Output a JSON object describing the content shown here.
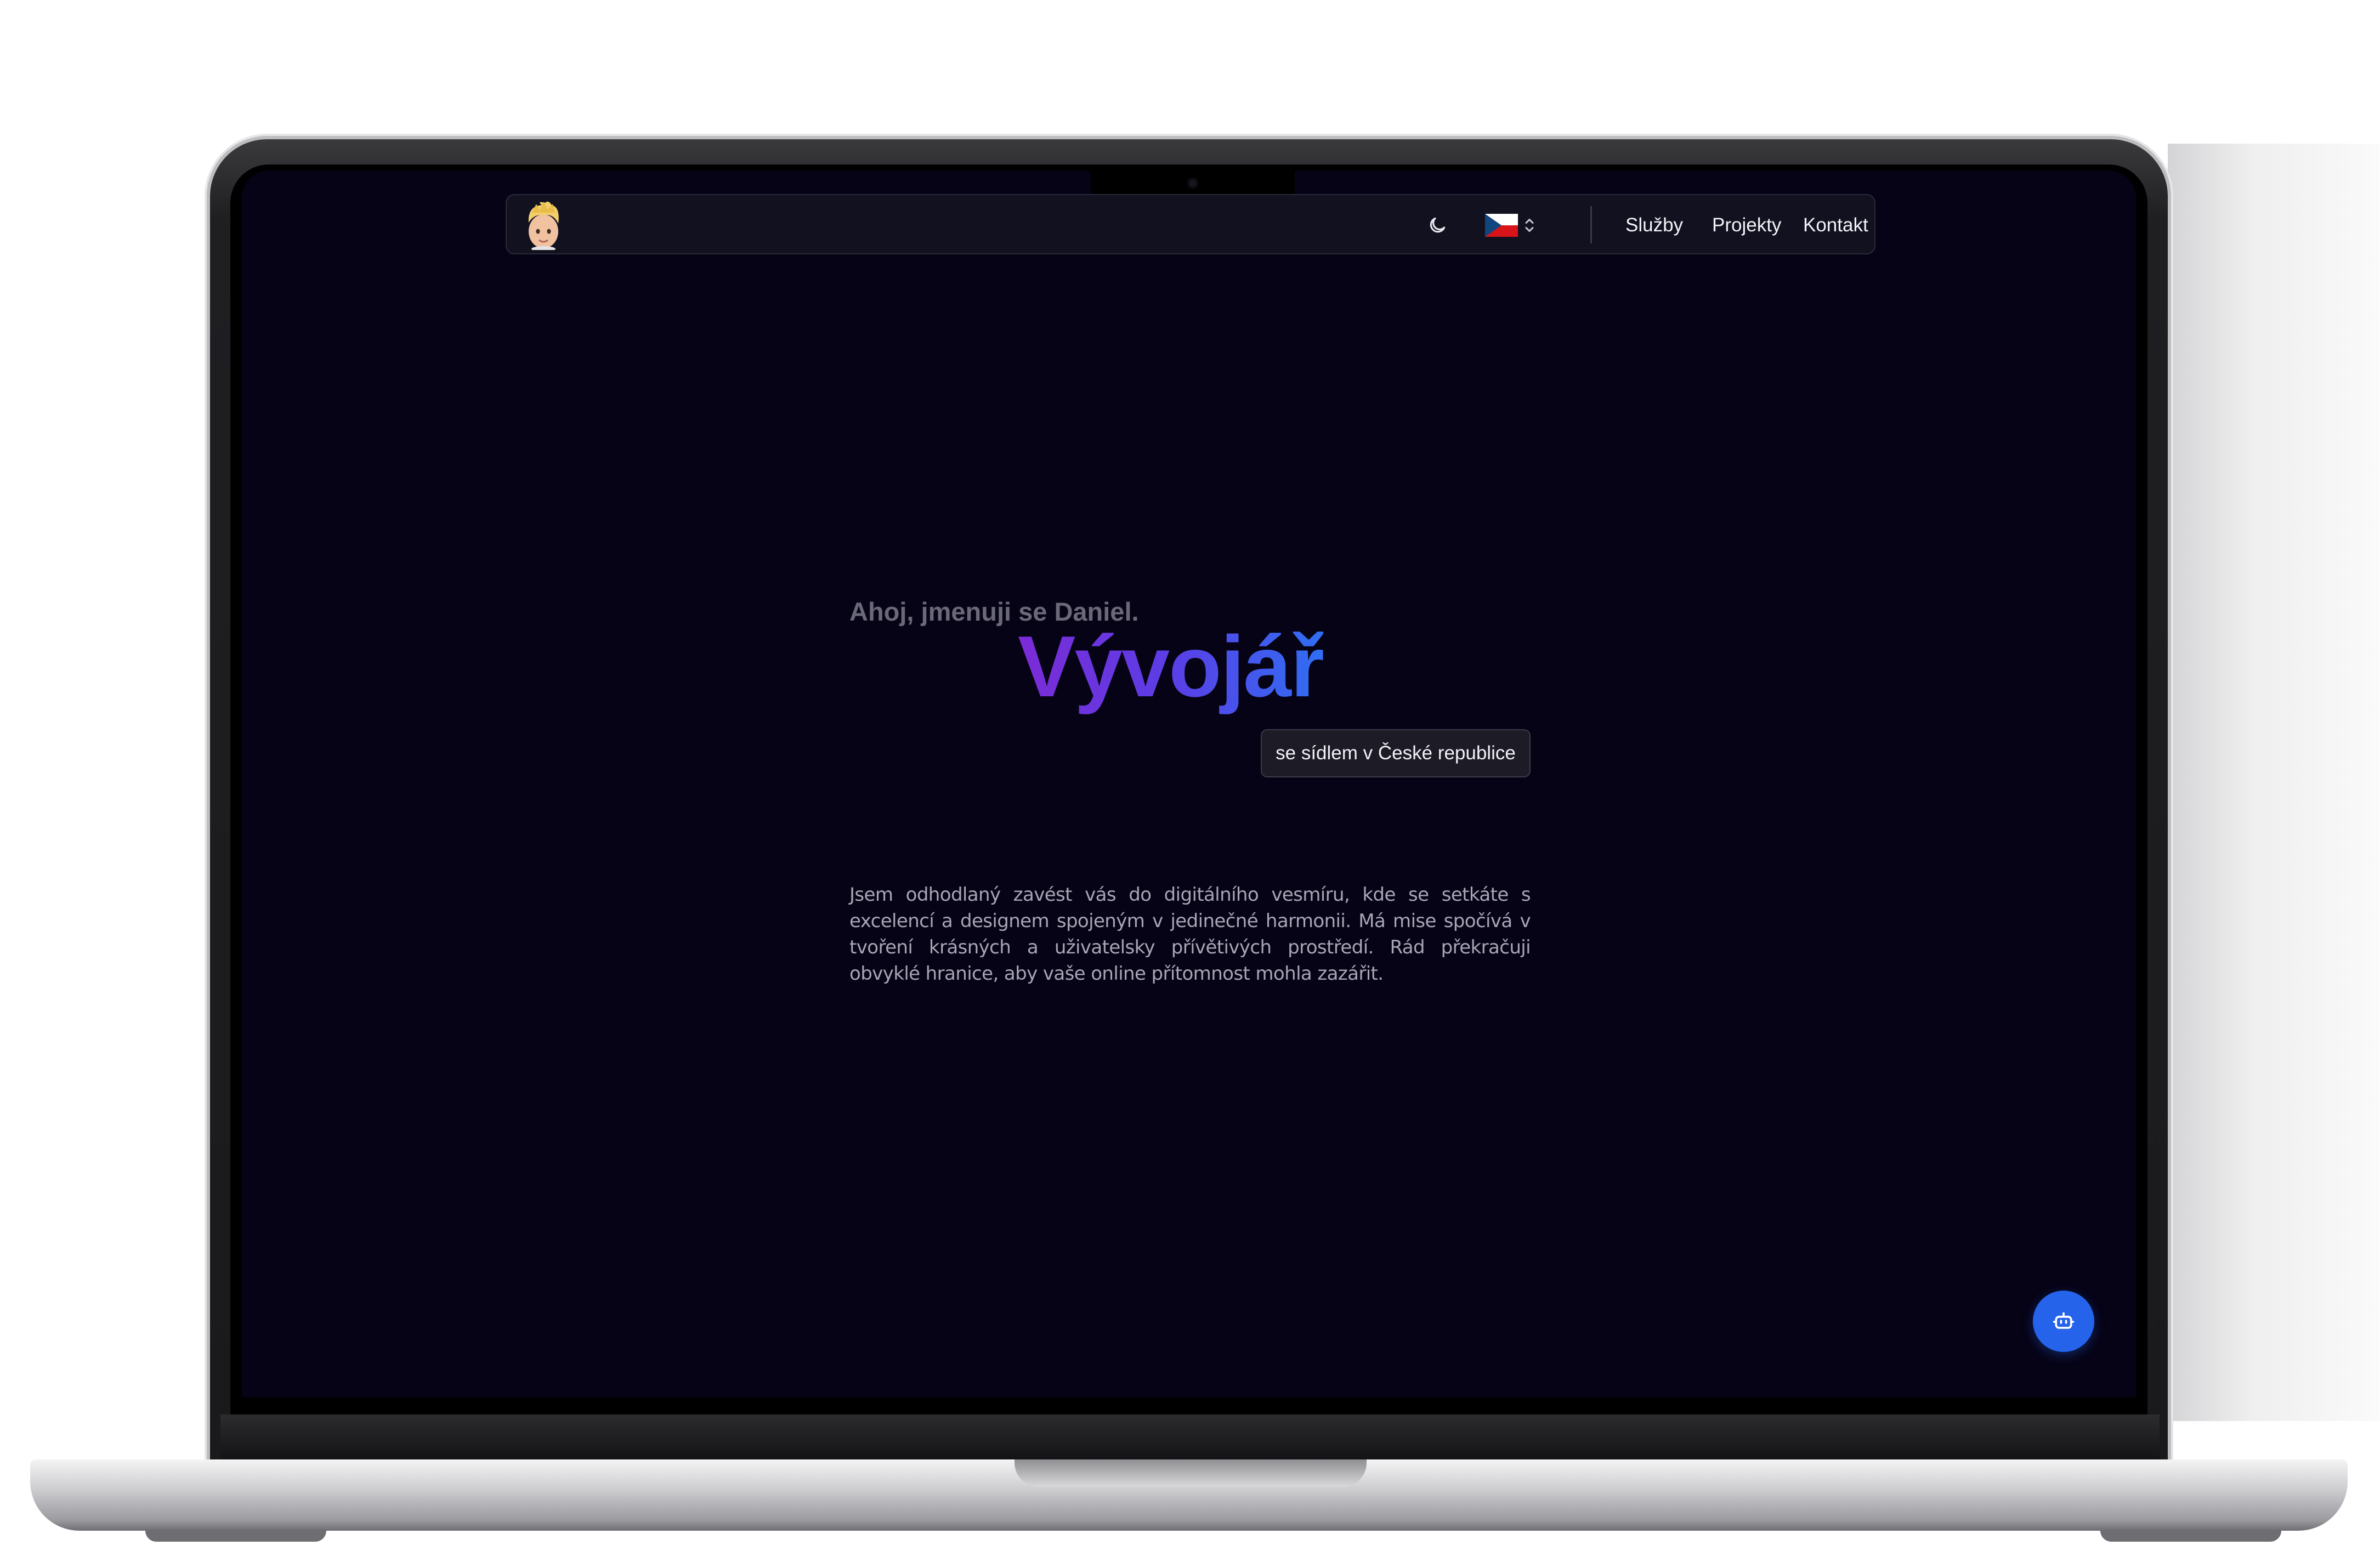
{
  "header": {
    "avatar_alt": "Daniel avatar",
    "theme_icon": "moon-icon",
    "language": "CZ",
    "flag_icon": "czech-flag-icon",
    "nav": [
      "Služby",
      "Projekty",
      "Kontakt"
    ]
  },
  "hero": {
    "greeting": "Ahoj, jmenuji se Daniel.",
    "headline": "Vývojář",
    "location": "se sídlem v České republice",
    "intro": "Jsem odhodlaný zavést vás do digitálního vesmíru, kde se setkáte s excelencí a designem spojeným v jedinečné harmonii. Má mise spočívá v tvoření krásných a uživatelsky přívětivých prostředí. Rád překračuji obvyklé hranice, aby vaše online přítomnost mohla zazářit."
  },
  "chat": {
    "icon": "bot-icon"
  },
  "colors": {
    "background": "#060316",
    "accent_blue": "#2563eb",
    "gradient_start": "#7b2bd6",
    "gradient_end": "#2f6ef2"
  }
}
